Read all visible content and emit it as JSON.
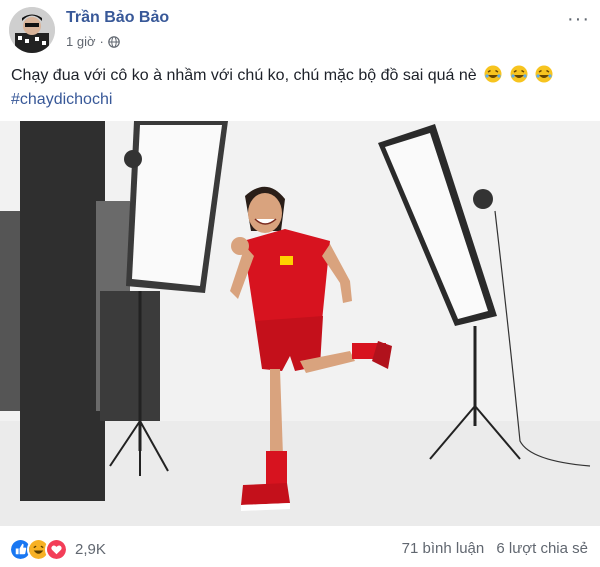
{
  "post": {
    "author": "Trần Bảo Bảo",
    "time": "1 giờ",
    "privacy_icon": "globe-icon",
    "text": "Chạy đua với cô ko à nhầm với chú ko, chú mặc bộ đồ sai quá nè",
    "text_emojis": [
      "laughing-emoji",
      "laughing-emoji",
      "laughing-emoji"
    ],
    "hashtag": "#chaydichochi"
  },
  "photo": {
    "jersey_color": "#d7131f",
    "background_color": "#f2f2f2"
  },
  "footer": {
    "reaction_icons": [
      "like-icon",
      "haha-icon",
      "love-icon"
    ],
    "reaction_count": "2,9K",
    "comments": "71 bình luận",
    "shares": "6 lượt chia sẻ"
  },
  "colors": {
    "link": "#385898",
    "secondary_text": "#616770",
    "like_blue": "#1877f2",
    "love_red": "#f33e58",
    "haha_yellow": "#f7b125"
  }
}
